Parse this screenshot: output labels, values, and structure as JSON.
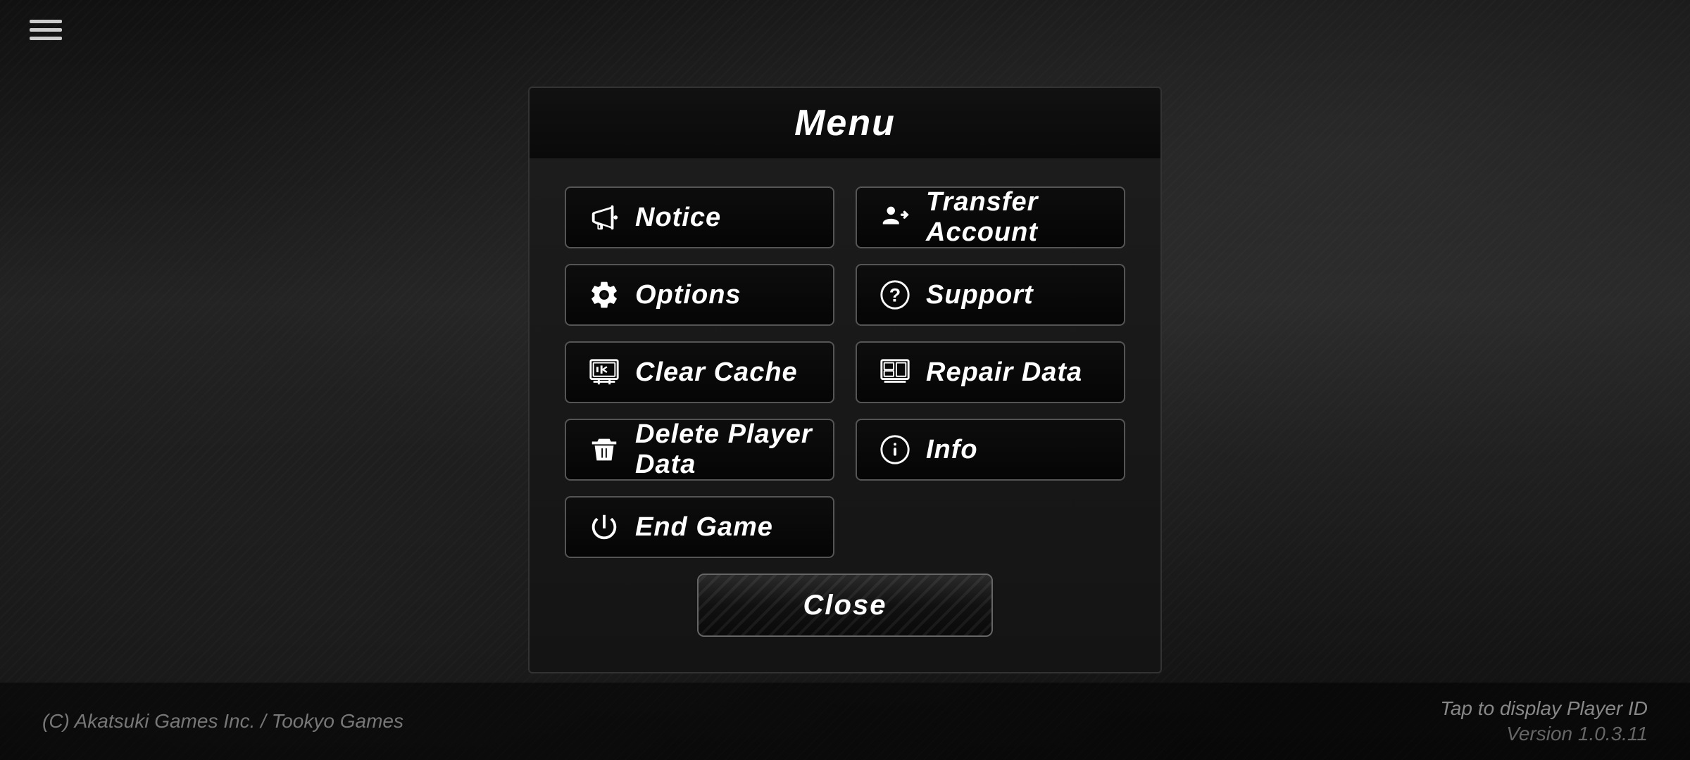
{
  "app": {
    "title": "Menu",
    "copyright": "(C) Akatsuki Games Inc. / Tookyo Games",
    "tap_display": "Tap to display Player ID",
    "version": "Version 1.0.3.11"
  },
  "menu": {
    "title": "Menu",
    "buttons": {
      "notice": {
        "label": "Notice",
        "icon": "megaphone"
      },
      "options": {
        "label": "Options",
        "icon": "gear"
      },
      "clear_cache": {
        "label": "Clear Cache",
        "icon": "clear-cache"
      },
      "delete_player_data": {
        "label": "Delete Player Data",
        "icon": "trash"
      },
      "end_game": {
        "label": "End Game",
        "icon": "power"
      },
      "transfer_account": {
        "label": "Transfer Account",
        "icon": "transfer"
      },
      "support": {
        "label": "Support",
        "icon": "question"
      },
      "repair_data": {
        "label": "Repair Data",
        "icon": "repair"
      },
      "info": {
        "label": "Info",
        "icon": "info"
      }
    },
    "close_label": "Close"
  }
}
